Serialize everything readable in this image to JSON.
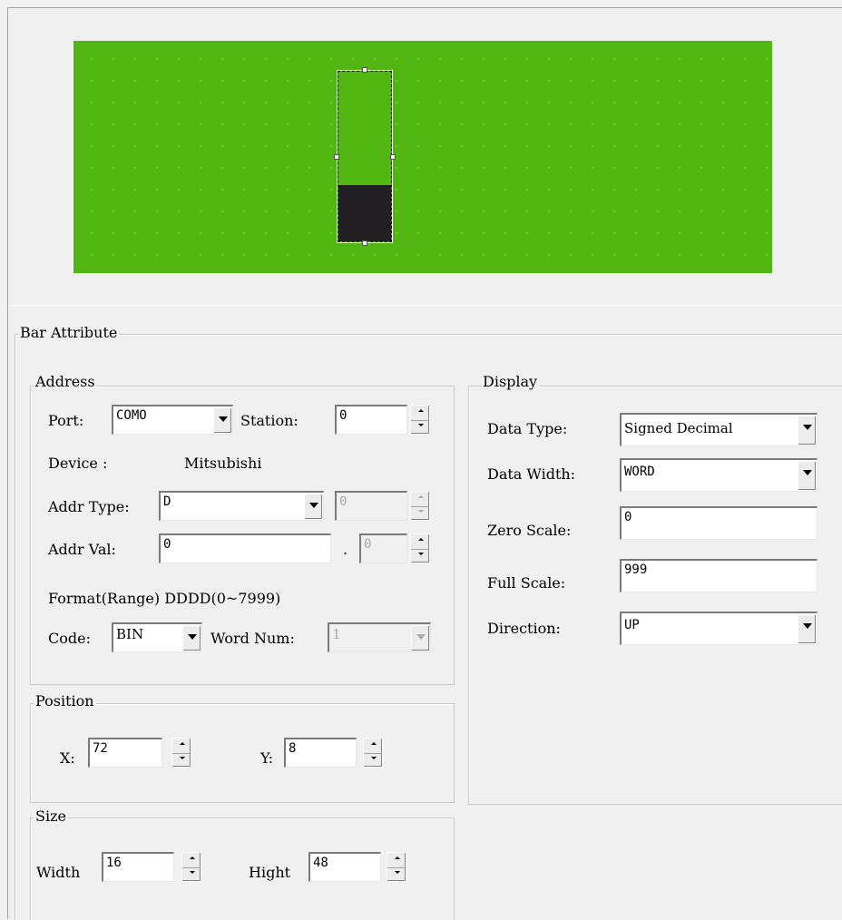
{
  "preview": {
    "canvas_color": "#52b612",
    "bar_fill_color": "#232023",
    "bar_fill_fraction": 0.33
  },
  "bar_attribute": {
    "title": "Bar Attribute"
  },
  "address": {
    "title": "Address",
    "port_label": "Port:",
    "port_value": "COMO",
    "station_label": "Station:",
    "station_value": "0",
    "device_label": "Device :",
    "device_value": "Mitsubishi",
    "addr_type_label": "Addr Type:",
    "addr_type_value": "D",
    "addr_type_sub_value": "0",
    "addr_val_label": "Addr Val:",
    "addr_val_value": "0",
    "addr_val_dot": ".",
    "addr_val_sub_value": "0",
    "format_text": "Format(Range) DDDD(0~7999)",
    "code_label": "Code:",
    "code_value": "BIN",
    "word_num_label": "Word Num:",
    "word_num_value": "1"
  },
  "position": {
    "title": "Position",
    "x_label": "X:",
    "x_value": "72",
    "y_label": "Y:",
    "y_value": "8"
  },
  "size": {
    "title": "Size",
    "width_label": "Width",
    "width_value": "16",
    "hight_label": "Hight",
    "hight_value": "48"
  },
  "display": {
    "title": "Display",
    "data_type_label": "Data Type:",
    "data_type_value": "Signed Decimal",
    "data_width_label": "Data Width:",
    "data_width_value": "WORD",
    "zero_scale_label": "Zero Scale:",
    "zero_scale_value": "0",
    "full_scale_label": "Full Scale:",
    "full_scale_value": "999",
    "direction_label": "Direction:",
    "direction_value": "UP"
  }
}
